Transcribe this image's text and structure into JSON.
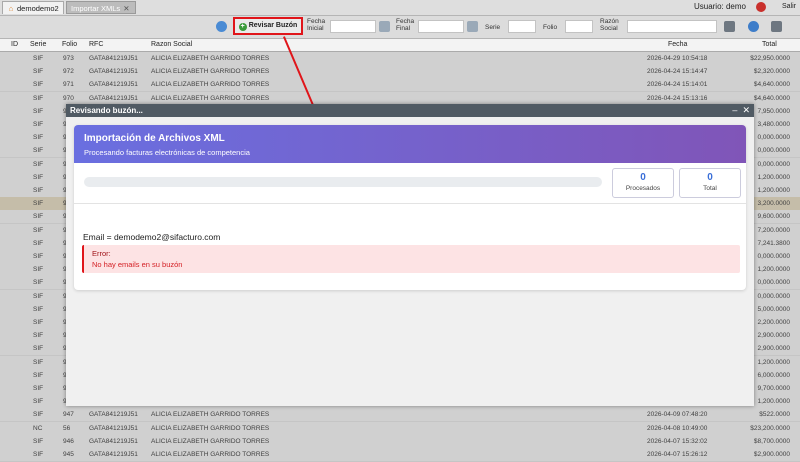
{
  "tabs": [
    {
      "label": "demodemo2"
    },
    {
      "label": "Importar XMLs",
      "close": "✕"
    }
  ],
  "user": {
    "label": "Usuario: demo",
    "logout": "Salir"
  },
  "toolbar": {
    "revisar_label": "Revisar Buzón",
    "fecha_inicial_label": "Fecha\nInicial",
    "fecha_final_label": "Fecha\nFinal",
    "serie_label": "Serie",
    "folio_label": "Folio",
    "razon_social_label": "Razón\nSocial"
  },
  "table": {
    "headers": [
      "ID",
      "Serie",
      "Folio",
      "RFC",
      "Razon Social",
      "Fecha",
      "Total"
    ],
    "rows": [
      {
        "serie": "SIF",
        "folio": "973",
        "rfc": "GATA841219J51",
        "razon": "ALICIA ELIZABETH GARRIDO TORRES",
        "fecha": "2026-04-29 10:54:18",
        "total": "$22,950.0000"
      },
      {
        "serie": "SIF",
        "folio": "972",
        "rfc": "GATA841219J51",
        "razon": "ALICIA ELIZABETH GARRIDO TORRES",
        "fecha": "2026-04-24 15:14:47",
        "total": "$2,320.0000"
      },
      {
        "serie": "SIF",
        "folio": "971",
        "rfc": "GATA841219J51",
        "razon": "ALICIA ELIZABETH GARRIDO TORRES",
        "fecha": "2026-04-24 15:14:01",
        "total": "$4,640.0000"
      },
      {
        "serie": "SIF",
        "folio": "970",
        "rfc": "GATA841219J51",
        "razon": "ALICIA ELIZABETH GARRIDO TORRES",
        "fecha": "2026-04-24 15:13:16",
        "total": "$4,640.0000"
      },
      {
        "serie": "SIF",
        "folio": "9",
        "rfc": "",
        "razon": "",
        "fecha": "",
        "total": "7,950.0000"
      },
      {
        "serie": "SIF",
        "folio": "9",
        "rfc": "",
        "razon": "",
        "fecha": "",
        "total": "3,480.0000"
      },
      {
        "serie": "SIF",
        "folio": "9",
        "rfc": "",
        "razon": "",
        "fecha": "",
        "total": "0,000.0000"
      },
      {
        "serie": "SIF",
        "folio": "9",
        "rfc": "",
        "razon": "",
        "fecha": "",
        "total": "0,000.0000"
      },
      {
        "serie": "SIF",
        "folio": "9",
        "rfc": "",
        "razon": "",
        "fecha": "",
        "total": "0,000.0000"
      },
      {
        "serie": "SIF",
        "folio": "9",
        "rfc": "",
        "razon": "",
        "fecha": "",
        "total": "1,200.0000"
      },
      {
        "serie": "SIF",
        "folio": "9",
        "rfc": "",
        "razon": "",
        "fecha": "",
        "total": "1,200.0000"
      },
      {
        "serie": "SIF",
        "folio": "9",
        "rfc": "",
        "razon": "",
        "fecha": "",
        "total": "3,200.0000"
      },
      {
        "serie": "SIF",
        "folio": "9",
        "rfc": "",
        "razon": "",
        "fecha": "",
        "total": "9,600.0000"
      },
      {
        "serie": "SIF",
        "folio": "9",
        "rfc": "",
        "razon": "",
        "fecha": "",
        "total": "7,200.0000"
      },
      {
        "serie": "SIF",
        "folio": "9",
        "rfc": "",
        "razon": "",
        "fecha": "",
        "total": "7,241.3800"
      },
      {
        "serie": "SIF",
        "folio": "9",
        "rfc": "",
        "razon": "",
        "fecha": "",
        "total": "0,000.0000"
      },
      {
        "serie": "SIF",
        "folio": "9",
        "rfc": "",
        "razon": "",
        "fecha": "",
        "total": "1,200.0000"
      },
      {
        "serie": "SIF",
        "folio": "9",
        "rfc": "",
        "razon": "",
        "fecha": "",
        "total": "0,000.0000"
      },
      {
        "serie": "SIF",
        "folio": "9",
        "rfc": "",
        "razon": "",
        "fecha": "",
        "total": "0,000.0000"
      },
      {
        "serie": "SIF",
        "folio": "9",
        "rfc": "",
        "razon": "",
        "fecha": "",
        "total": "5,000.0000"
      },
      {
        "serie": "SIF",
        "folio": "9",
        "rfc": "",
        "razon": "",
        "fecha": "",
        "total": "2,200.0000"
      },
      {
        "serie": "SIF",
        "folio": "9",
        "rfc": "",
        "razon": "",
        "fecha": "",
        "total": "2,900.0000"
      },
      {
        "serie": "SIF",
        "folio": "9",
        "rfc": "",
        "razon": "",
        "fecha": "",
        "total": "2,900.0000"
      },
      {
        "serie": "SIF",
        "folio": "9",
        "rfc": "",
        "razon": "",
        "fecha": "",
        "total": "1,200.0000"
      },
      {
        "serie": "SIF",
        "folio": "9",
        "rfc": "",
        "razon": "",
        "fecha": "",
        "total": "6,000.0000"
      },
      {
        "serie": "SIF",
        "folio": "9",
        "rfc": "",
        "razon": "",
        "fecha": "",
        "total": "9,700.0000"
      },
      {
        "serie": "SIF",
        "folio": "9",
        "rfc": "",
        "razon": "",
        "fecha": "",
        "total": "1,200.0000"
      },
      {
        "serie": "SIF",
        "folio": "947",
        "rfc": "GATA841219J51",
        "razon": "ALICIA ELIZABETH GARRIDO TORRES",
        "fecha": "2026-04-09 07:48:20",
        "total": "$522.0000"
      },
      {
        "serie": "NC",
        "folio": "56",
        "rfc": "GATA841219J51",
        "razon": "ALICIA ELIZABETH GARRIDO TORRES",
        "fecha": "2026-04-08 10:49:00",
        "total": "$23,200.0000"
      },
      {
        "serie": "SIF",
        "folio": "946",
        "rfc": "GATA841219J51",
        "razon": "ALICIA ELIZABETH GARRIDO TORRES",
        "fecha": "2026-04-07 15:32:02",
        "total": "$8,700.0000"
      },
      {
        "serie": "SIF",
        "folio": "945",
        "rfc": "GATA841219J51",
        "razon": "ALICIA ELIZABETH GARRIDO TORRES",
        "fecha": "2026-04-07 15:26:12",
        "total": "$2,900.0000"
      }
    ]
  },
  "dialog": {
    "title": "Revisando buzón...",
    "minimize": "–",
    "close": "✕",
    "heading": "Importación de Archivos XML",
    "subheading": "Procesando facturas electrónicas de competencia",
    "progress_percent": 0,
    "processed_count": "0",
    "processed_label": "Procesados",
    "total_count": "0",
    "total_label": "Total",
    "email_line": "Email = demodemo2@sifacturo.com",
    "error_title": "Error:",
    "error_message": "No hay emails en su buzón"
  },
  "colors": {
    "header_gradient_start": "#6a6fe0",
    "header_gradient_end": "#8055b8",
    "error_red": "#d42025",
    "highlight_red": "#e0151a",
    "count_blue": "#3a6fd8"
  }
}
